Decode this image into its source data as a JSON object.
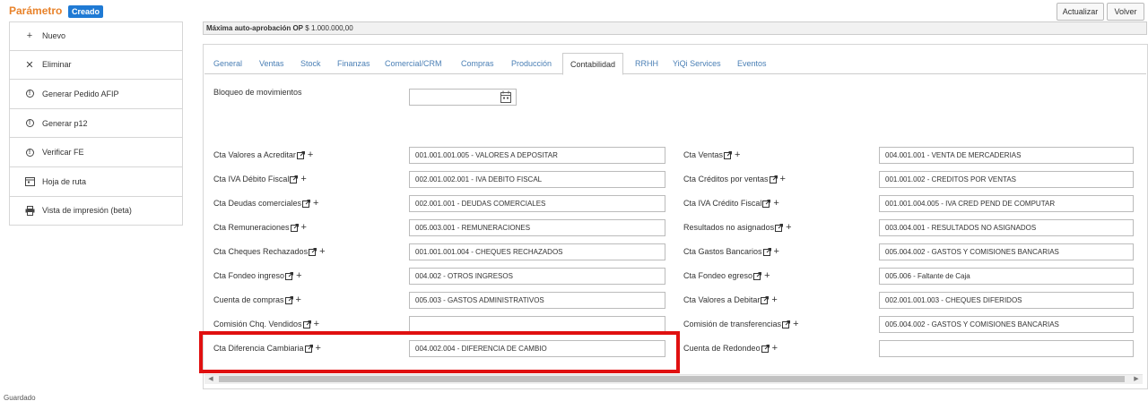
{
  "header": {
    "title": "Parámetro",
    "badge": "Creado",
    "actualizar_label": "Actualizar",
    "volver_label": "Volver"
  },
  "sidebar": {
    "items": [
      {
        "icon": "plus-icon",
        "label": "Nuevo"
      },
      {
        "icon": "close-icon",
        "label": "Eliminar"
      },
      {
        "icon": "info-icon",
        "label": "Generar Pedido AFIP"
      },
      {
        "icon": "info-icon",
        "label": "Generar p12"
      },
      {
        "icon": "info-icon",
        "label": "Verificar FE"
      },
      {
        "icon": "calendar-icon",
        "label": "Hoja de ruta"
      },
      {
        "icon": "print-icon",
        "label": "Vista de impresión (beta)"
      }
    ]
  },
  "infobar": {
    "label": "Máxima auto-aprobación OP",
    "value": "$ 1.000.000,00"
  },
  "tabs": [
    "General",
    "Ventas",
    "Stock",
    "Finanzas",
    "Comercial/CRM",
    "Compras",
    "Producción",
    "Contabilidad",
    "RRHH",
    "YiQi Services",
    "Eventos"
  ],
  "active_tab": "Contabilidad",
  "form": {
    "bloqueo_label": "Bloqueo de movimientos",
    "bloqueo_value": "",
    "left": [
      {
        "label": "Cta Valores a Acreditar",
        "value": "001.001.001.005 - VALORES A DEPOSITAR"
      },
      {
        "label": "Cta IVA Débito Fiscal",
        "value": "002.001.002.001 - IVA DEBITO FISCAL"
      },
      {
        "label": "Cta Deudas comerciales",
        "value": "002.001.001 - DEUDAS COMERCIALES"
      },
      {
        "label": "Cta Remuneraciones",
        "value": "005.003.001 - REMUNERACIONES"
      },
      {
        "label": "Cta Cheques Rechazados",
        "value": "001.001.001.004 - CHEQUES RECHAZADOS"
      },
      {
        "label": "Cta Fondeo ingreso",
        "value": "004.002 - OTROS INGRESOS"
      },
      {
        "label": "Cuenta de compras",
        "value": "005.003 - GASTOS ADMINISTRATIVOS"
      },
      {
        "label": "Comisión Chq. Vendidos",
        "value": ""
      },
      {
        "label": "Cta Diferencia Cambiaria",
        "value": "004.002.004 - DIFERENCIA DE CAMBIO"
      }
    ],
    "right": [
      {
        "label": "Cta Ventas",
        "value": "004.001.001 - VENTA DE MERCADERIAS"
      },
      {
        "label": "Cta Créditos por ventas",
        "value": "001.001.002 - CREDITOS POR VENTAS"
      },
      {
        "label": "Cta IVA Crédito Fiscal",
        "value": "001.001.004.005 - IVA CRED PEND DE COMPUTAR"
      },
      {
        "label": "Resultados no asignados",
        "value": "003.004.001 - RESULTADOS NO ASIGNADOS"
      },
      {
        "label": "Cta Gastos Bancarios",
        "value": "005.004.002 - GASTOS Y COMISIONES BANCARIAS"
      },
      {
        "label": "Cta Fondeo egreso",
        "value": "005.006 - Faltante de Caja"
      },
      {
        "label": "Cta Valores a Debitar",
        "value": "002.001.001.003 - CHEQUES DIFERIDOS"
      },
      {
        "label": "Comisión de transferencias",
        "value": "005.004.002 - GASTOS Y COMISIONES BANCARIAS"
      },
      {
        "label": "Cuenta de Redondeo",
        "value": ""
      }
    ]
  },
  "colors": {
    "title": "#e8822a",
    "badge": "#1f7ad4",
    "tab_link": "#4a7fb5",
    "highlight": "#e01010"
  },
  "footer": "Guardado"
}
